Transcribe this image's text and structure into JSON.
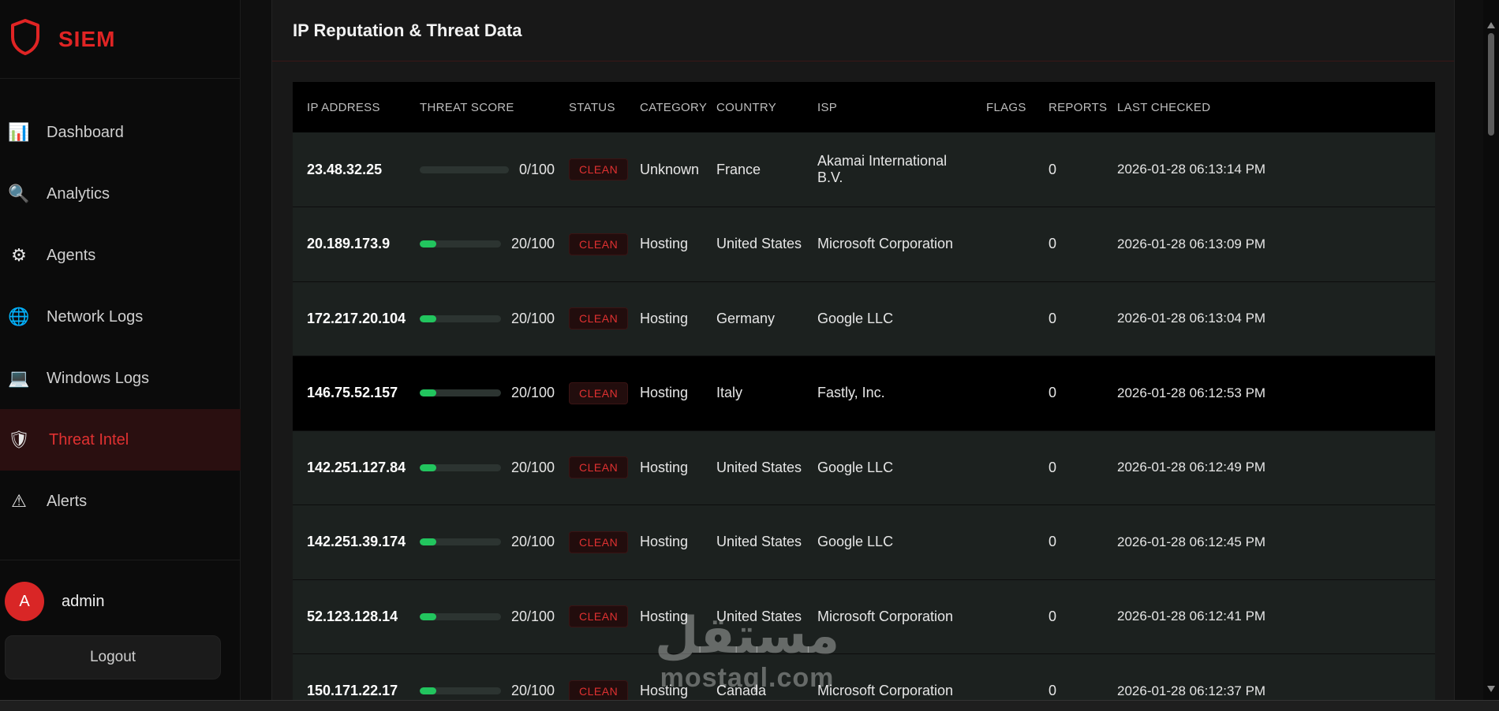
{
  "brand": {
    "title": "SIEM"
  },
  "sidebar": {
    "items": [
      {
        "label": "Dashboard",
        "icon": "chart-icon",
        "glyph": "📊"
      },
      {
        "label": "Analytics",
        "icon": "search-icon",
        "glyph": "🔍"
      },
      {
        "label": "Agents",
        "icon": "gear-icon",
        "glyph": "⚙"
      },
      {
        "label": "Network Logs",
        "icon": "globe-icon",
        "glyph": "🌐"
      },
      {
        "label": "Windows Logs",
        "icon": "laptop-icon",
        "glyph": "💻"
      },
      {
        "label": "Threat Intel",
        "icon": "shield-icon",
        "glyph": "🛡"
      },
      {
        "label": "Alerts",
        "icon": "warning-icon",
        "glyph": "⚠"
      }
    ],
    "active_index": 5
  },
  "user": {
    "initial": "A",
    "name": "admin"
  },
  "logout_label": "Logout",
  "panel": {
    "title": "IP Reputation & Threat Data"
  },
  "table": {
    "columns": [
      "IP ADDRESS",
      "THREAT SCORE",
      "STATUS",
      "CATEGORY",
      "COUNTRY",
      "ISP",
      "FLAGS",
      "REPORTS",
      "LAST CHECKED"
    ],
    "rows": [
      {
        "ip": "23.48.32.25",
        "score_value": 0,
        "score": "0/100",
        "status": "CLEAN",
        "category": "Unknown",
        "country": "France",
        "isp": "Akamai International B.V.",
        "flags": "",
        "reports": "0",
        "last_checked": "2026-01-28 06:13:14 PM"
      },
      {
        "ip": "20.189.173.9",
        "score_value": 20,
        "score": "20/100",
        "status": "CLEAN",
        "category": "Hosting",
        "country": "United States",
        "isp": "Microsoft Corporation",
        "flags": "",
        "reports": "0",
        "last_checked": "2026-01-28 06:13:09 PM"
      },
      {
        "ip": "172.217.20.104",
        "score_value": 20,
        "score": "20/100",
        "status": "CLEAN",
        "category": "Hosting",
        "country": "Germany",
        "isp": "Google LLC",
        "flags": "",
        "reports": "0",
        "last_checked": "2026-01-28 06:13:04 PM"
      },
      {
        "ip": "146.75.52.157",
        "score_value": 20,
        "score": "20/100",
        "status": "CLEAN",
        "category": "Hosting",
        "country": "Italy",
        "isp": "Fastly, Inc.",
        "flags": "",
        "reports": "0",
        "last_checked": "2026-01-28 06:12:53 PM"
      },
      {
        "ip": "142.251.127.84",
        "score_value": 20,
        "score": "20/100",
        "status": "CLEAN",
        "category": "Hosting",
        "country": "United States",
        "isp": "Google LLC",
        "flags": "",
        "reports": "0",
        "last_checked": "2026-01-28 06:12:49 PM"
      },
      {
        "ip": "142.251.39.174",
        "score_value": 20,
        "score": "20/100",
        "status": "CLEAN",
        "category": "Hosting",
        "country": "United States",
        "isp": "Google LLC",
        "flags": "",
        "reports": "0",
        "last_checked": "2026-01-28 06:12:45 PM"
      },
      {
        "ip": "52.123.128.14",
        "score_value": 20,
        "score": "20/100",
        "status": "CLEAN",
        "category": "Hosting",
        "country": "United States",
        "isp": "Microsoft Corporation",
        "flags": "",
        "reports": "0",
        "last_checked": "2026-01-28 06:12:41 PM"
      },
      {
        "ip": "150.171.22.17",
        "score_value": 20,
        "score": "20/100",
        "status": "CLEAN",
        "category": "Hosting",
        "country": "Canada",
        "isp": "Microsoft Corporation",
        "flags": "",
        "reports": "0",
        "last_checked": "2026-01-28 06:12:37 PM"
      }
    ],
    "highlighted_row": 3
  },
  "watermark": {
    "arabic": "مستقل",
    "latin": "mostaql.com"
  },
  "colors": {
    "accent": "#e02424",
    "score_fill": "#22c55e",
    "row_bg": "#1c211f",
    "badge_text": "#e03131"
  }
}
